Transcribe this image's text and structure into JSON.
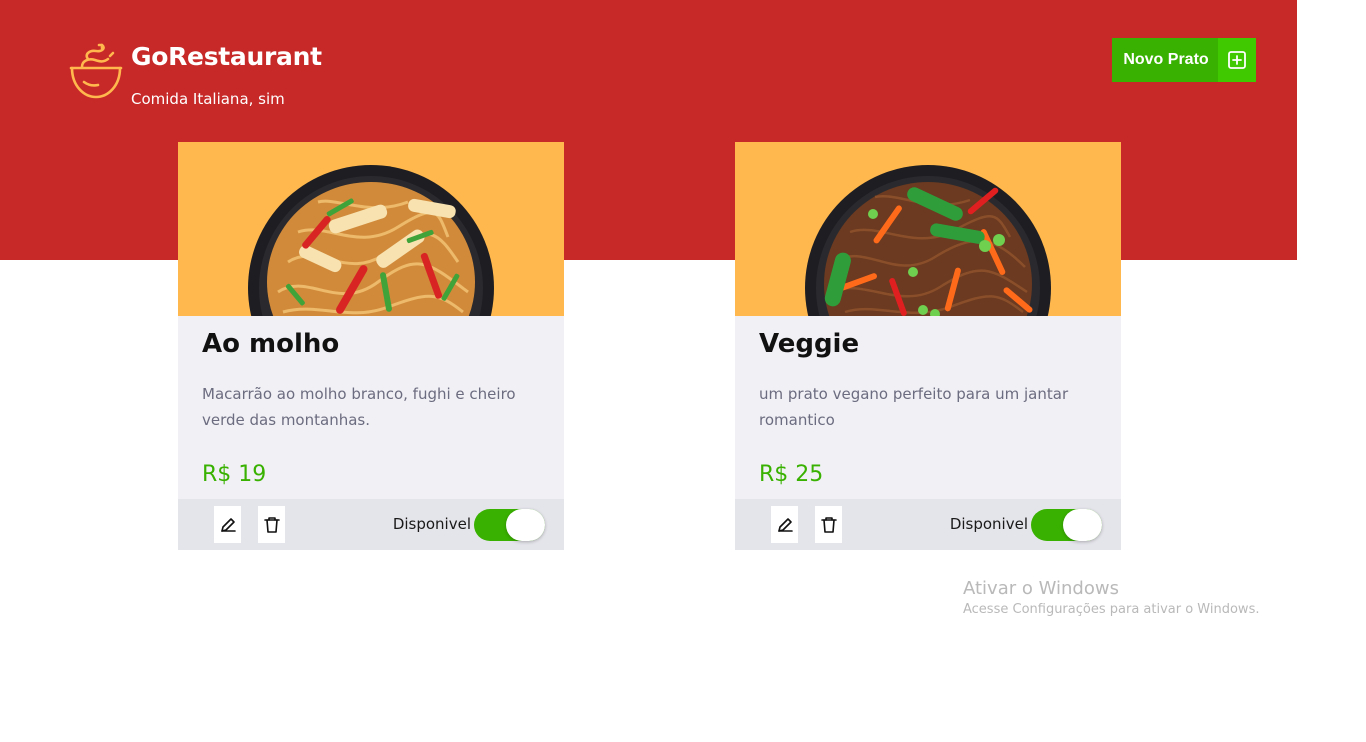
{
  "header": {
    "brand_title": "GoRestaurant",
    "brand_subtitle": "Comida Italiana, sim",
    "new_dish_label": "Novo Prato",
    "logo_icon": "bowl-icon",
    "new_dish_icon": "plus-square-icon"
  },
  "colors": {
    "header_bg": "#c72828",
    "card_bg": "#f0f0f5",
    "card_image_bg": "#ffb84d",
    "footer_bg": "#e4e4eb",
    "accent_green": "#39b100",
    "accent_green_light": "#41c900"
  },
  "dishes": [
    {
      "name": "Ao molho",
      "description": "Macarrão ao molho branco, fughi e cheiro verde das montanhas.",
      "price": "R$ 19",
      "availability_label": "Disponivel",
      "available": true,
      "edit_icon": "pencil-icon",
      "delete_icon": "trash-icon"
    },
    {
      "name": "Veggie",
      "description": "um prato vegano perfeito para um jantar romantico",
      "price": "R$ 25",
      "availability_label": "Disponivel",
      "available": true,
      "edit_icon": "pencil-icon",
      "delete_icon": "trash-icon"
    }
  ],
  "windows_watermark": {
    "title": "Ativar o Windows",
    "subtitle": "Acesse Configurações para ativar o Windows."
  }
}
